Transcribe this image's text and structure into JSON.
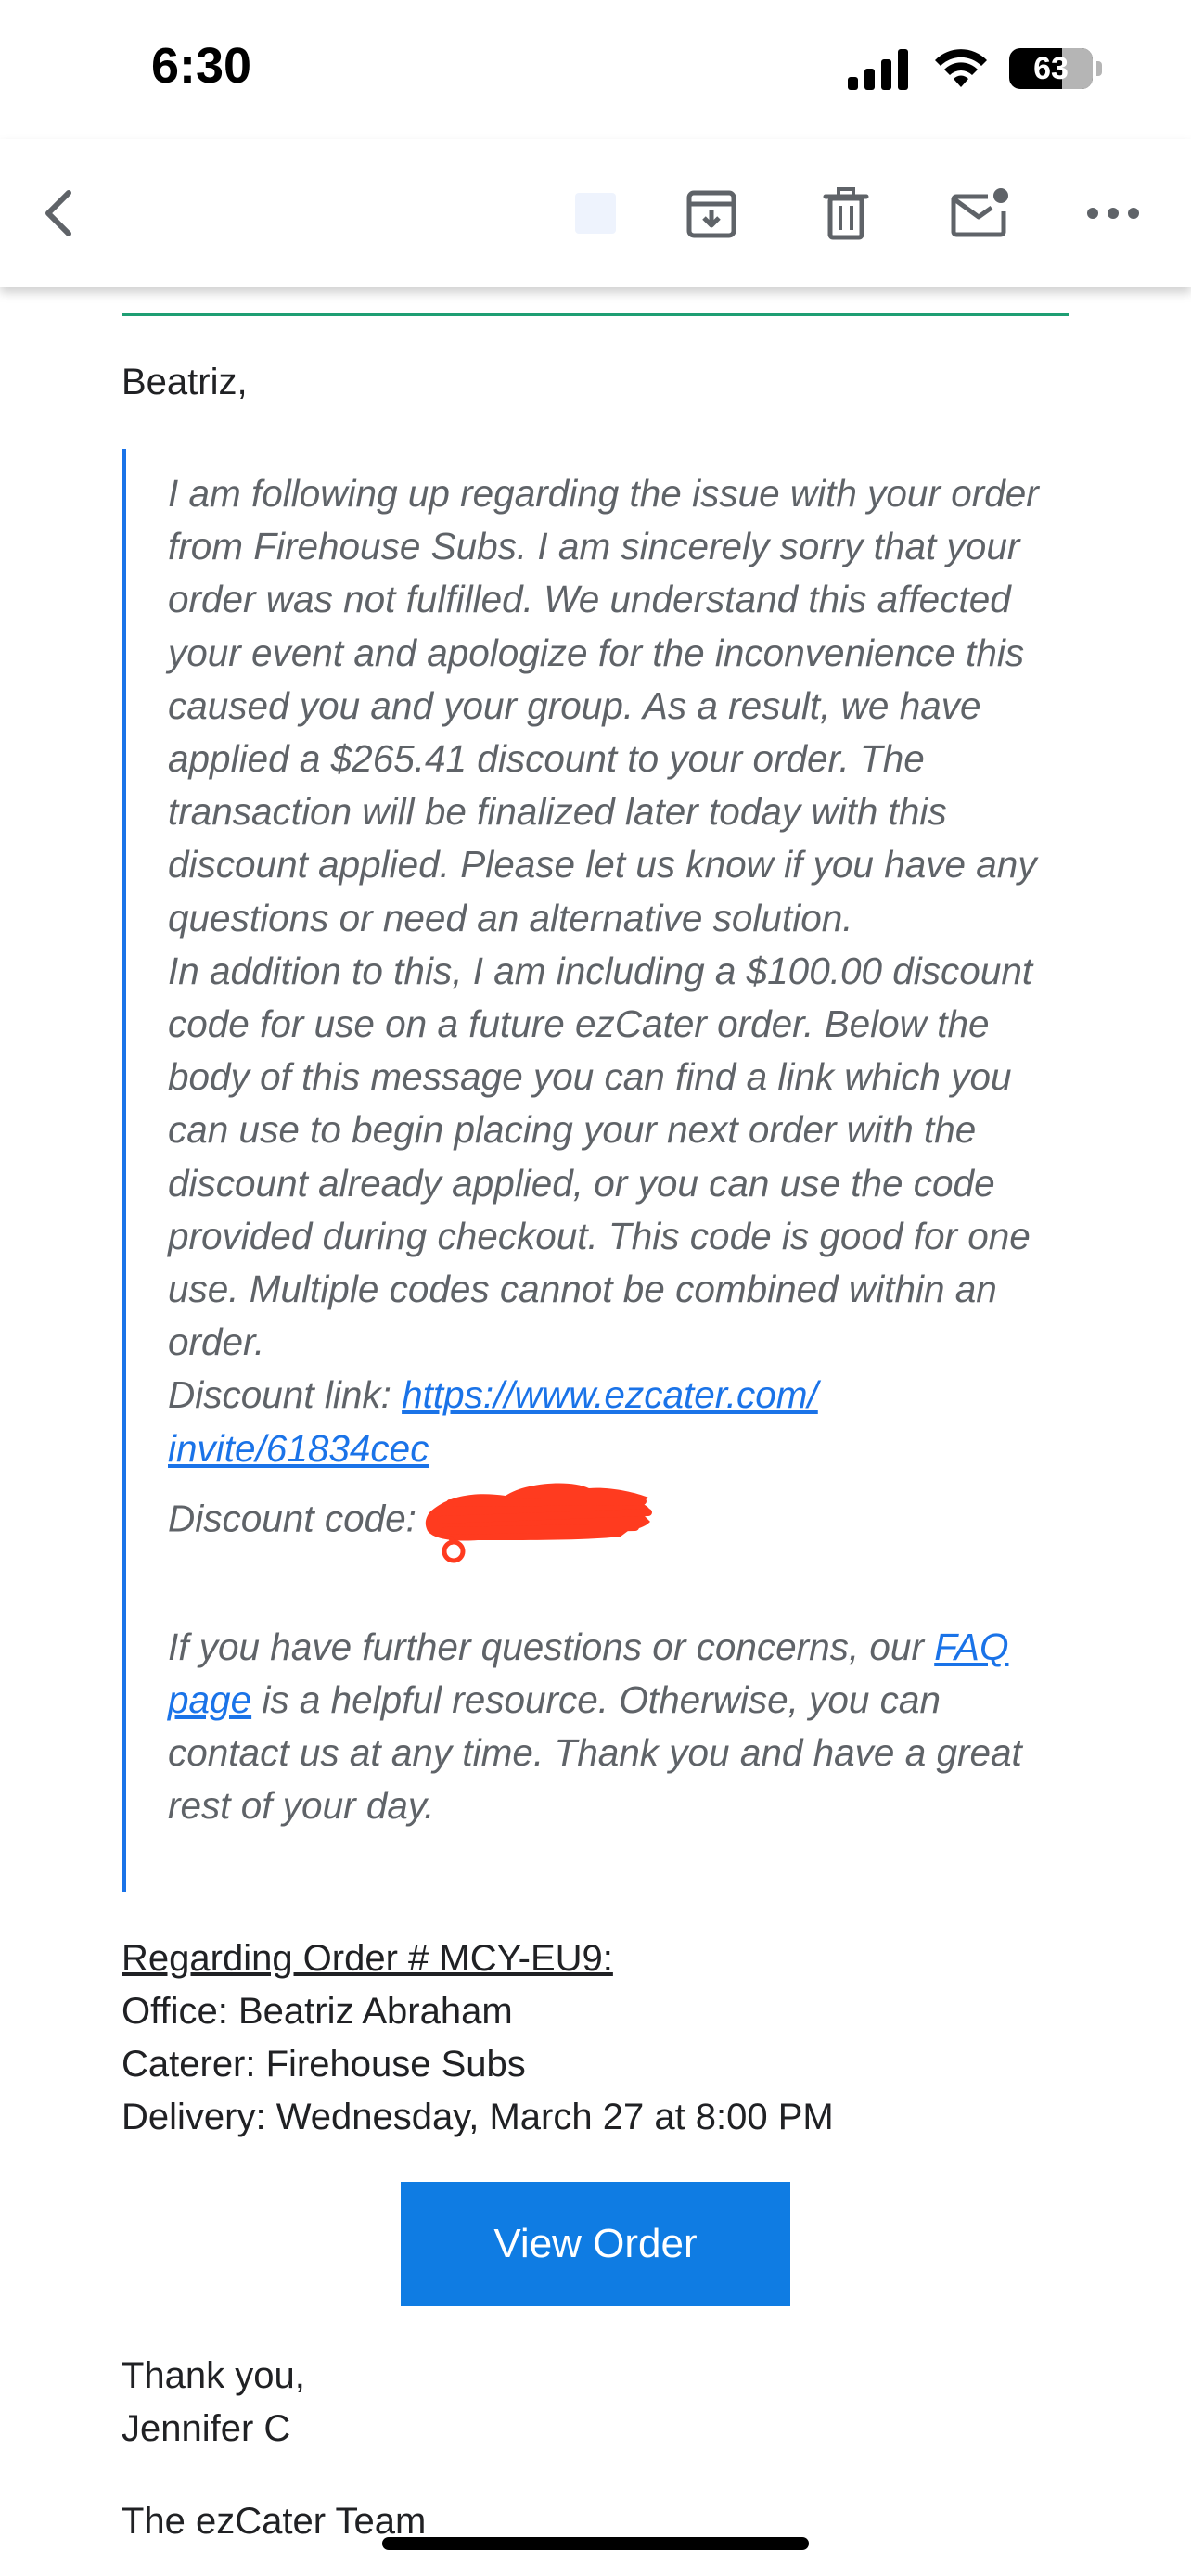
{
  "status_bar": {
    "time": "6:30",
    "battery_percent": "63",
    "battery_level": 0.63
  },
  "toolbar": {
    "icons": [
      "back-arrow-icon",
      "label-icon",
      "archive-icon",
      "delete-icon",
      "mark-unread-icon",
      "more-icon"
    ]
  },
  "email": {
    "greeting": "Beatriz,",
    "quote": {
      "line1": "I am following up regarding the issue with your order from Firehouse Subs. I am sincerely sorry that your order was not fulfilled. We understand this affected your event and apologize for the inconvenience this caused you and your group. As a result, we have applied a $265.41 discount to your order. The transaction will be finalized later today with this discount applied. Please let us know if you have any questions or need an alternative solution.",
      "line2": "In addition to this, I am including a $100.00 discount code for use on a future ezCater order. Below the body of this message you can find a link which you can use to begin placing your next order with the discount already applied, or you can use the code provided during checkout. This code is good for one use. Multiple codes cannot be combined within an order.",
      "discount_link_label": "Discount link: ",
      "discount_link_url_1": "https://www.ezcater.com/",
      "discount_link_url_2": "invite/61834cec",
      "discount_code_label": "Discount code:",
      "further_1": "If you have further questions or concerns, our ",
      "faq_link_1": "FAQ",
      "faq_link_2": "page",
      "further_2": " is a helpful resource. Otherwise, you can contact us at any time. Thank you and have a great rest of your day."
    },
    "order": {
      "reference": "Regarding Order # MCY-EU9:",
      "office": "Office: Beatriz Abraham",
      "caterer": "Caterer: Firehouse Subs",
      "delivery": "Delivery: Wednesday, March 27 at 8:00 PM"
    },
    "view_order_label": "View Order",
    "thanks": "Thank you,",
    "sender": "Jennifer C",
    "team": "The ezCater Team"
  },
  "colors": {
    "accent": "#1a73e8",
    "divider": "#1e9e73",
    "button": "#0f7ce3",
    "redaction": "#ff3b1f"
  }
}
